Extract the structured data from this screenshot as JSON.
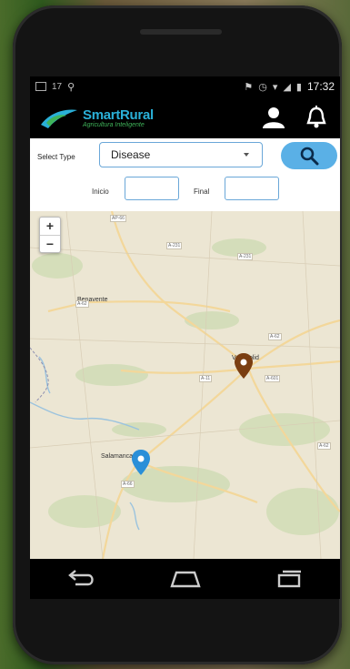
{
  "status_bar": {
    "signal_text": "17",
    "time": "17:32"
  },
  "app": {
    "logo_name": "SmartRural",
    "logo_tagline": "Agricultura Inteligente"
  },
  "filters": {
    "select_type_label": "Select Type",
    "select_value": "Disease",
    "inicio_label": "Inicio",
    "final_label": "Final",
    "inicio_value": "",
    "final_value": ""
  },
  "map": {
    "zoom_in": "+",
    "zoom_out": "−",
    "cities": {
      "benavente": "Benavente",
      "valladolid": "Valladolid",
      "salamanca": "Salamanca"
    },
    "roads": {
      "ap66": "AP-66",
      "a231": "A-231",
      "a231b": "A-231",
      "a62": "A-62",
      "a11": "A-11",
      "a62b": "A-62",
      "a601": "A-601",
      "a66": "A-66",
      "a62c": "A-62"
    },
    "marker_colors": {
      "brown": "#7a3e12",
      "blue": "#2a8fd8"
    }
  },
  "colors": {
    "accent": "#5ab0e6",
    "logo_blue": "#2ab0d8",
    "logo_green": "#3fb45a"
  }
}
